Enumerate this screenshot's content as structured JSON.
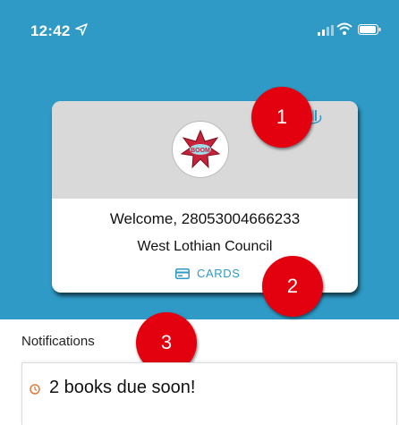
{
  "status_bar": {
    "time": "12:42"
  },
  "card": {
    "welcome": "Welcome, 28053004666233",
    "library": "West Lothian Council",
    "cards_label": "CARDS"
  },
  "badges": [
    "1",
    "2",
    "3"
  ],
  "notifications": {
    "title": "Notifications",
    "items": [
      {
        "text": "2 books due soon!"
      }
    ]
  },
  "colors": {
    "accent": "#2e9ac5",
    "badge": "#e3000f",
    "notif_icon": "#e07b39"
  }
}
